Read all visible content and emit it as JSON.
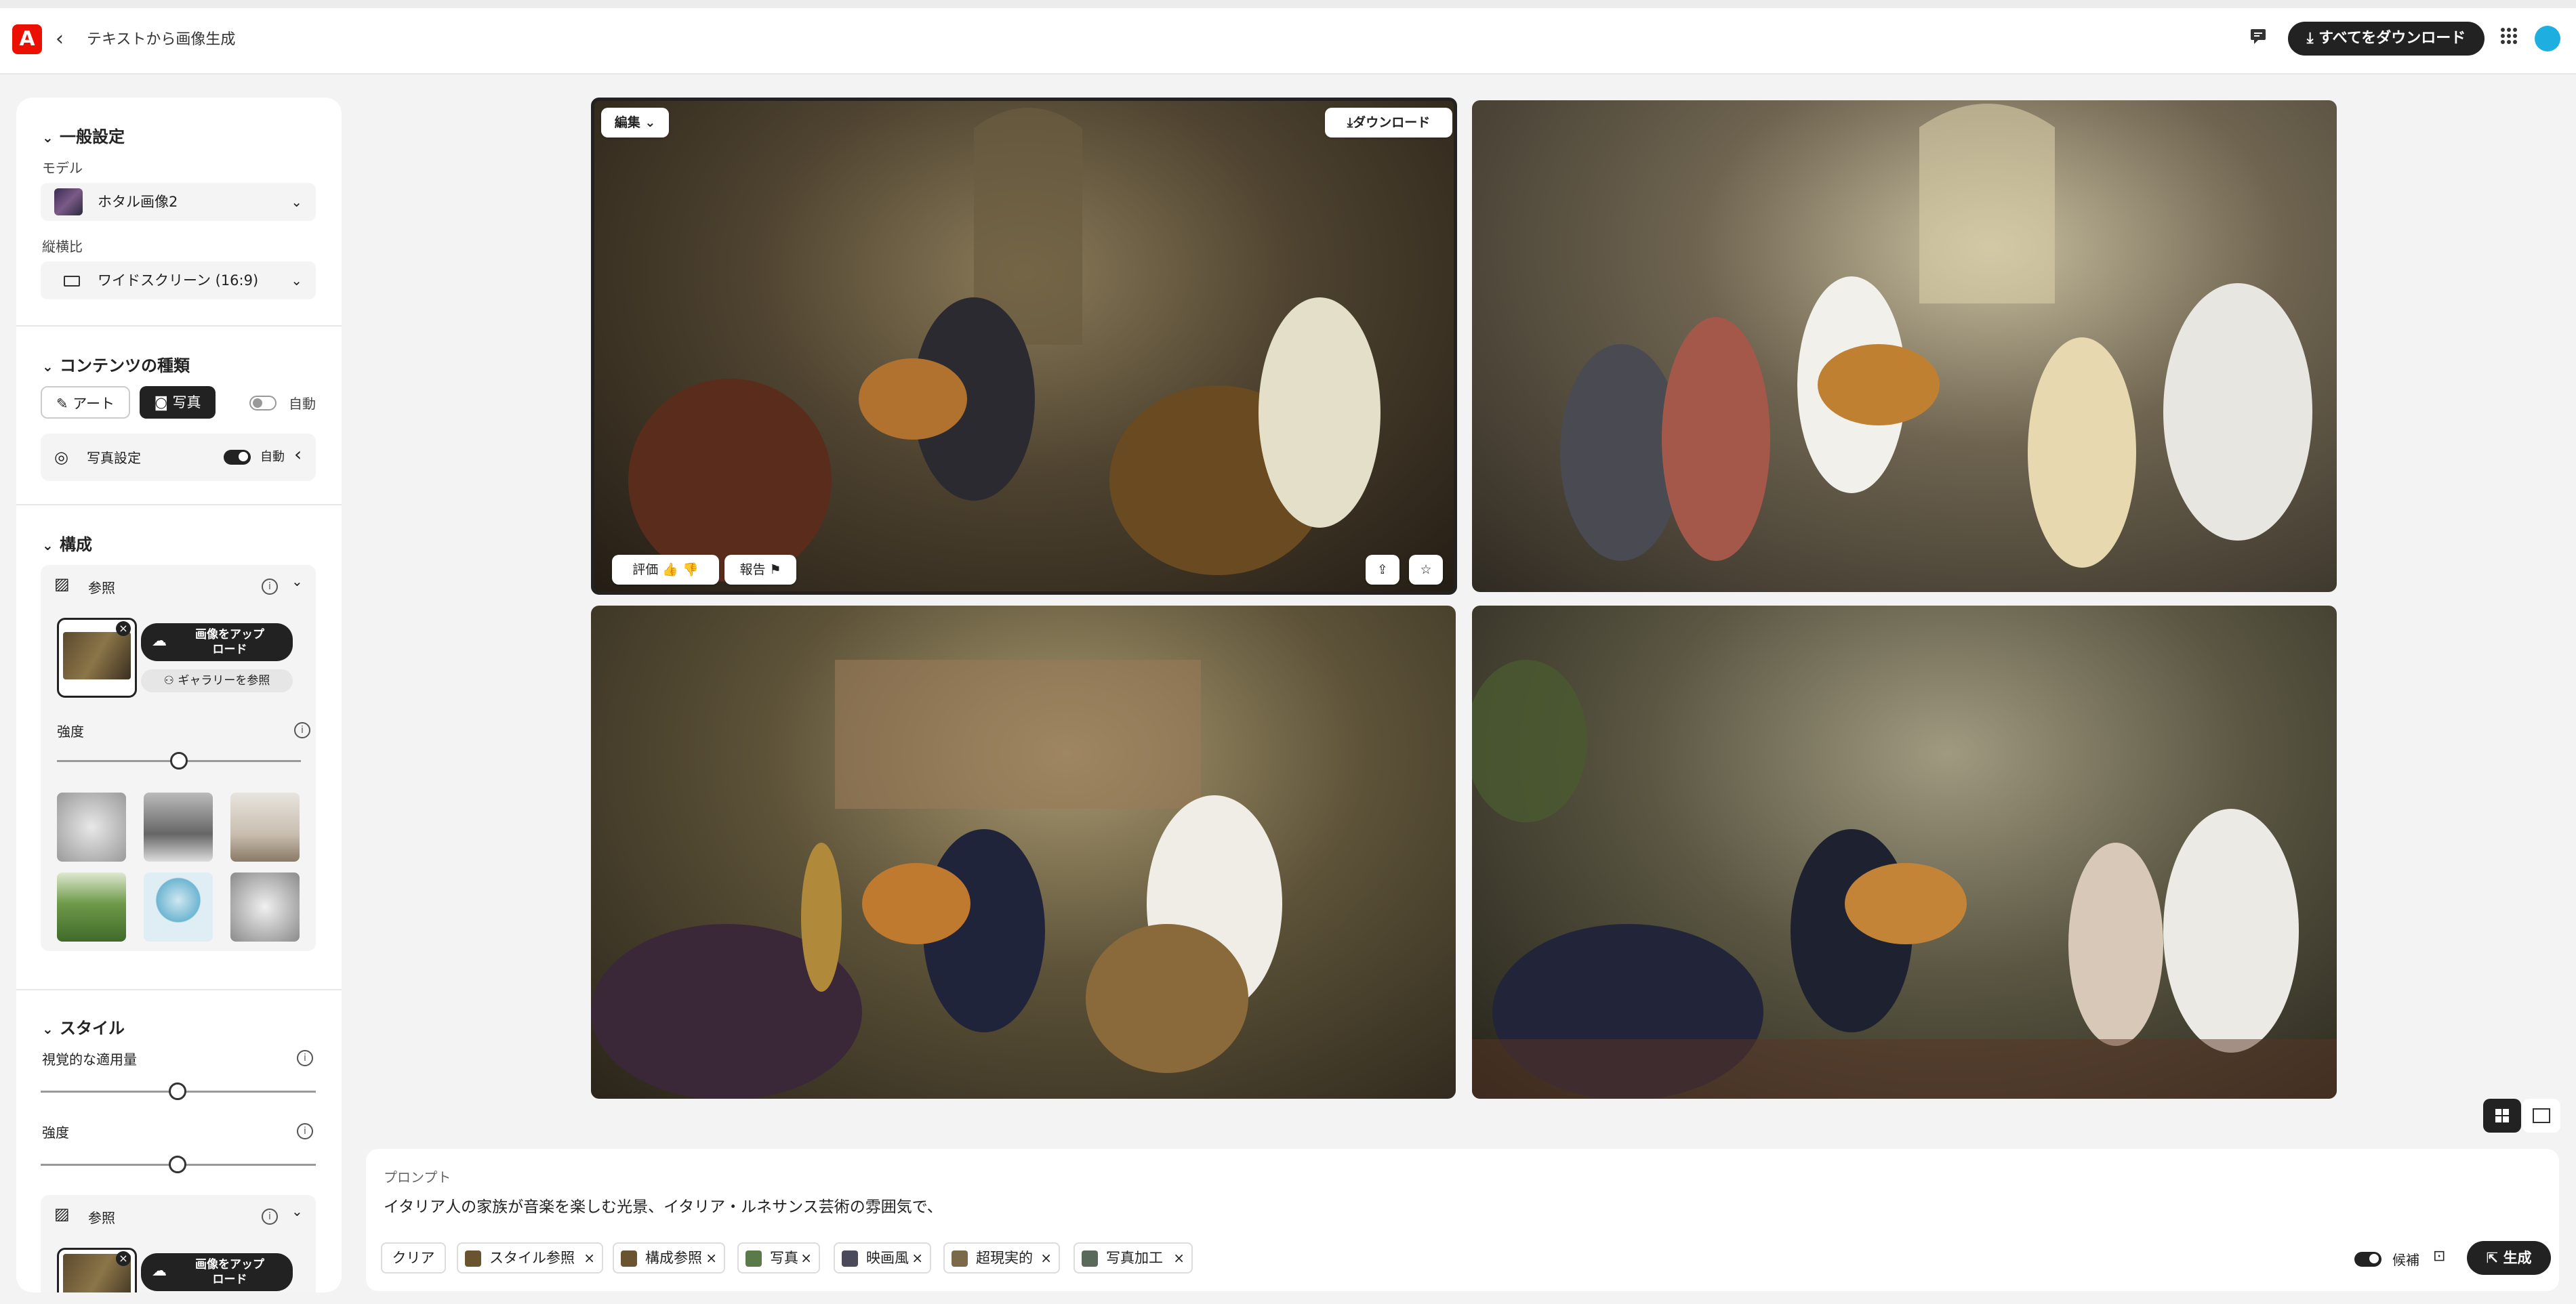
{
  "header": {
    "title": "テキストから画像生成",
    "download_all": "すべてをダウンロード"
  },
  "sidebar": {
    "general": {
      "title": "一般設定",
      "model_label": "モデル",
      "model_value": "ホタル画像2",
      "aspect_label": "縦横比",
      "aspect_value": "ワイドスクリーン (16:9)"
    },
    "content_type": {
      "title": "コンテンツの種類",
      "art": "アート",
      "photo": "写真",
      "auto": "自動",
      "photo_settings": "写真設定",
      "photo_settings_auto": "自動"
    },
    "composition": {
      "title": "構成",
      "reference": "参照",
      "upload": "画像をアップロード",
      "gallery": "ギャラリーを参照",
      "strength": "強度",
      "strength_value": 0.5
    },
    "style": {
      "title": "スタイル",
      "visual_intensity": "視覚的な適用量",
      "visual_intensity_value": 0.5,
      "strength": "強度",
      "strength_value": 0.5,
      "reference": "参照",
      "upload": "画像をアップロード"
    }
  },
  "gallery": {
    "edit": "編集",
    "download": "ダウンロード",
    "rate": "評価",
    "report": "報告"
  },
  "prompt": {
    "label": "プロンプト",
    "text": "イタリア人の家族が音楽を楽しむ光景、イタリア・ルネサンス芸術の雰囲気で、",
    "clear": "クリア",
    "chips": [
      "スタイル参照",
      "構成参照",
      "写真",
      "映画風",
      "超現実的",
      "写真加工"
    ],
    "candidate": "候補",
    "generate": "生成"
  }
}
